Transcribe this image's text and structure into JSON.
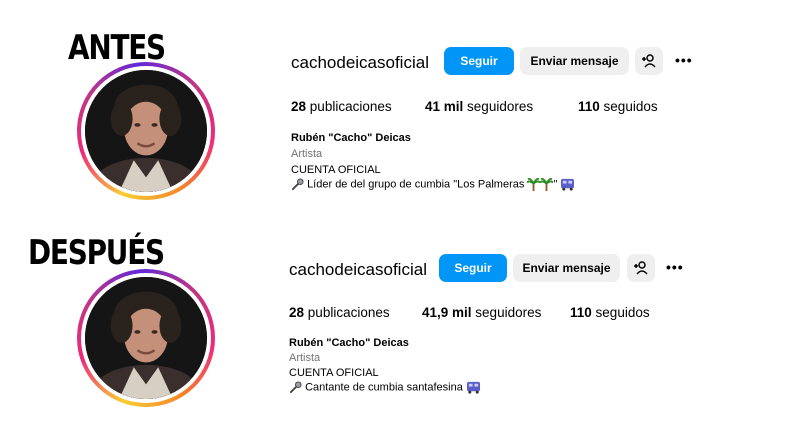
{
  "before": {
    "label": "ANTES",
    "username": "cachodeicasoficial",
    "follow_label": "Seguir",
    "message_label": "Enviar mensaje",
    "more_label": "•••",
    "stats": {
      "posts_count": "28",
      "posts_label": "publicaciones",
      "followers_count": "41 mil",
      "followers_label": "seguidores",
      "following_count": "110",
      "following_label": "seguidos"
    },
    "bio": {
      "name": "Rubén \"Cacho\" Deicas",
      "category": "Artista",
      "line1": "CUENTA OFICIAL",
      "line2": "Líder de del grupo de cumbia \"Los Palmeras"
    }
  },
  "after": {
    "label": "DESPUÉS",
    "username": "cachodeicasoficial",
    "follow_label": "Seguir",
    "message_label": "Enviar mensaje",
    "more_label": "•••",
    "stats": {
      "posts_count": "28",
      "posts_label": "publicaciones",
      "followers_count": "41,9 mil",
      "followers_label": "seguidores",
      "following_count": "110",
      "following_label": "seguidos"
    },
    "bio": {
      "name": "Rubén \"Cacho\" Deicas",
      "category": "Artista",
      "line1": "CUENTA OFICIAL",
      "line2": "Cantante de cumbia santafesina"
    }
  },
  "icons": {
    "add_person": "add-person-icon",
    "microphone": "microphone-icon",
    "palm_tree": "palm-tree-icon",
    "bus": "bus-icon"
  },
  "colors": {
    "follow_button": "#0095f6",
    "secondary_button": "#efefef",
    "category_text": "#737373"
  }
}
